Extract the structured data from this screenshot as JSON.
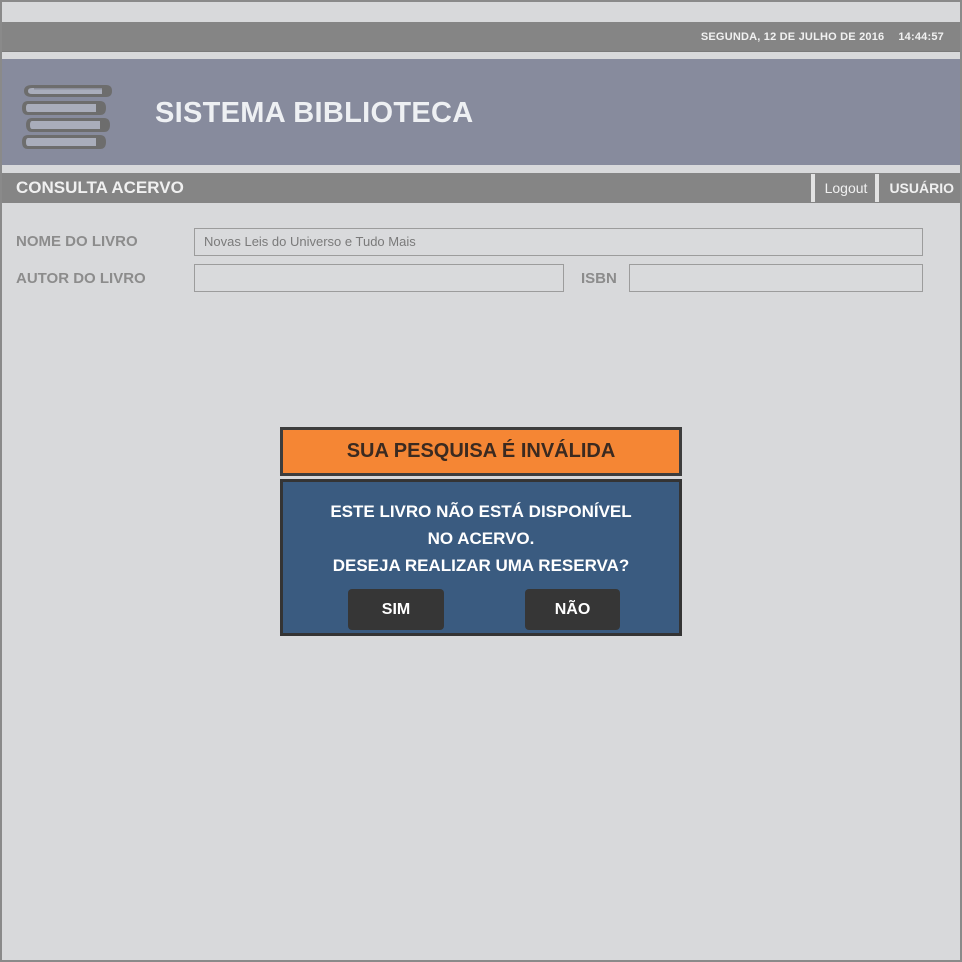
{
  "header": {
    "date": "SEGUNDA, 12 DE JULHO DE 2016",
    "time": "14:44:57",
    "system_title": "SISTEMA BIBLIOTECA",
    "logo_icon": "books-stack-icon"
  },
  "nav": {
    "page_title": "CONSULTA ACERVO",
    "logout_label": "Logout",
    "user_label": "USUÁRIO"
  },
  "form": {
    "book_name_label": "NOME DO LIVRO",
    "book_name_value": "Novas Leis do Universo e Tudo Mais",
    "author_label": "AUTOR DO LIVRO",
    "author_value": "",
    "isbn_label": "ISBN",
    "isbn_value": ""
  },
  "dialog": {
    "title": "SUA PESQUISA É INVÁLIDA",
    "line1": "ESTE LIVRO NÃO ESTÁ DISPONÍVEL",
    "line2": "NO ACERVO.",
    "line3": "DESEJA REALIZAR UMA RESERVA?",
    "yes_label": "SIM",
    "no_label": "NÃO"
  },
  "colors": {
    "topbar": "#858585",
    "banner": "#878b9d",
    "dialog_header": "#f58634",
    "dialog_body": "#3a5b80",
    "button": "#363636"
  }
}
